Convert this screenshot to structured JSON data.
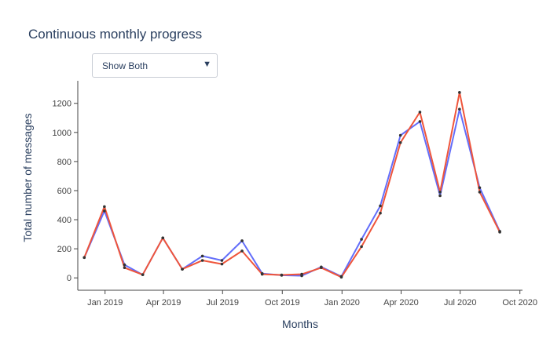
{
  "title": "Continuous monthly progress",
  "dropdown": {
    "selected": "Show Both"
  },
  "colors": {
    "series1": "#636efa",
    "series2": "#ef553b",
    "marker": "#333333",
    "axis": "#444444"
  },
  "chart_data": {
    "type": "line",
    "title": "Continuous monthly progress",
    "xlabel": "Months",
    "ylabel": "Total number of messages",
    "xlim": [
      "2018-11-20",
      "2020-10-05"
    ],
    "ylim": [
      -85,
      1355
    ],
    "x_ticks": [
      {
        "date": "2019-01-01",
        "label": "Jan 2019"
      },
      {
        "date": "2019-04-01",
        "label": "Apr 2019"
      },
      {
        "date": "2019-07-01",
        "label": "Jul 2019"
      },
      {
        "date": "2019-10-01",
        "label": "Oct 2019"
      },
      {
        "date": "2020-01-01",
        "label": "Jan 2020"
      },
      {
        "date": "2020-04-01",
        "label": "Apr 2020"
      },
      {
        "date": "2020-07-01",
        "label": "Jul 2020"
      },
      {
        "date": "2020-10-01",
        "label": "Oct 2020"
      }
    ],
    "y_ticks": [
      0,
      200,
      400,
      600,
      800,
      1000,
      1200
    ],
    "x": [
      "2018-11-30",
      "2018-12-31",
      "2019-01-31",
      "2019-02-28",
      "2019-03-31",
      "2019-04-30",
      "2019-05-31",
      "2019-06-30",
      "2019-07-31",
      "2019-08-31",
      "2019-09-30",
      "2019-10-31",
      "2019-11-30",
      "2019-12-31",
      "2020-01-31",
      "2020-02-29",
      "2020-03-31",
      "2020-04-30",
      "2020-05-31",
      "2020-06-30",
      "2020-07-31",
      "2020-08-31"
    ],
    "series": [
      {
        "values": [
          140,
          460,
          90,
          22,
          275,
          60,
          150,
          120,
          255,
          30,
          18,
          15,
          75,
          10,
          265,
          495,
          980,
          1075,
          565,
          1160,
          620,
          320
        ]
      },
      {
        "values": [
          140,
          490,
          70,
          22,
          275,
          60,
          120,
          95,
          185,
          25,
          20,
          25,
          70,
          5,
          215,
          445,
          930,
          1140,
          590,
          1275,
          590,
          315
        ]
      }
    ],
    "grid": false
  }
}
